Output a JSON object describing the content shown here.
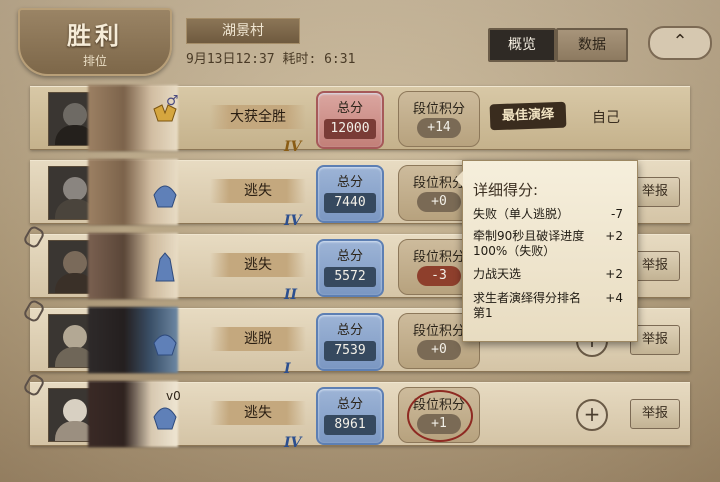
{
  "header": {
    "result_title": "胜利",
    "result_subtitle": "排位",
    "map_name": "湖景村",
    "match_time": "9月13日12:37  耗时: 6:31",
    "tabs": [
      {
        "label": "概览",
        "active": true
      },
      {
        "label": "数据",
        "active": false
      }
    ],
    "collapse_icon": "chevron-up-icon"
  },
  "players": [
    {
      "rank": "IV",
      "rank_tier": "gold",
      "gender_symbol": "♂",
      "result": "大获全胜",
      "score_label": "总分",
      "score": "12000",
      "rank_points_label": "段位积分",
      "rank_points": "+14",
      "badge": "最佳演绎",
      "self_label": "自己",
      "score_style": "red"
    },
    {
      "rank": "IV",
      "rank_tier": "blue",
      "result": "逃失",
      "score_label": "总分",
      "score": "7440",
      "rank_points_label": "段位积分",
      "rank_points": "+0",
      "report_label": "举报"
    },
    {
      "rank": "II",
      "rank_tier": "blue",
      "result": "逃失",
      "score_label": "总分",
      "score": "5572",
      "rank_points_label": "段位积分",
      "rank_points": "-3",
      "report_label": "举报"
    },
    {
      "rank": "I",
      "rank_tier": "blue",
      "result": "逃脱",
      "score_label": "总分",
      "score": "7539",
      "rank_points_label": "段位积分",
      "rank_points": "+0",
      "add_label": "+",
      "report_label": "举报"
    },
    {
      "rank": "IV",
      "rank_tier": "blue",
      "result": "逃失",
      "score_label": "总分",
      "score": "8961",
      "rank_points_label": "段位积分",
      "rank_points": "+1",
      "add_label": "+",
      "report_label": "举报",
      "name_fragment": "v0"
    }
  ],
  "score_detail": {
    "title": "详细得分:",
    "items": [
      {
        "label": "失败（单人逃脱）",
        "value": "-7"
      },
      {
        "label": "牵制90秒且破译进度100%（失败）",
        "value": "+2"
      },
      {
        "label": "力战天选",
        "value": "+2"
      },
      {
        "label": "求生者演绎得分排名第1",
        "value": "+4"
      }
    ]
  }
}
